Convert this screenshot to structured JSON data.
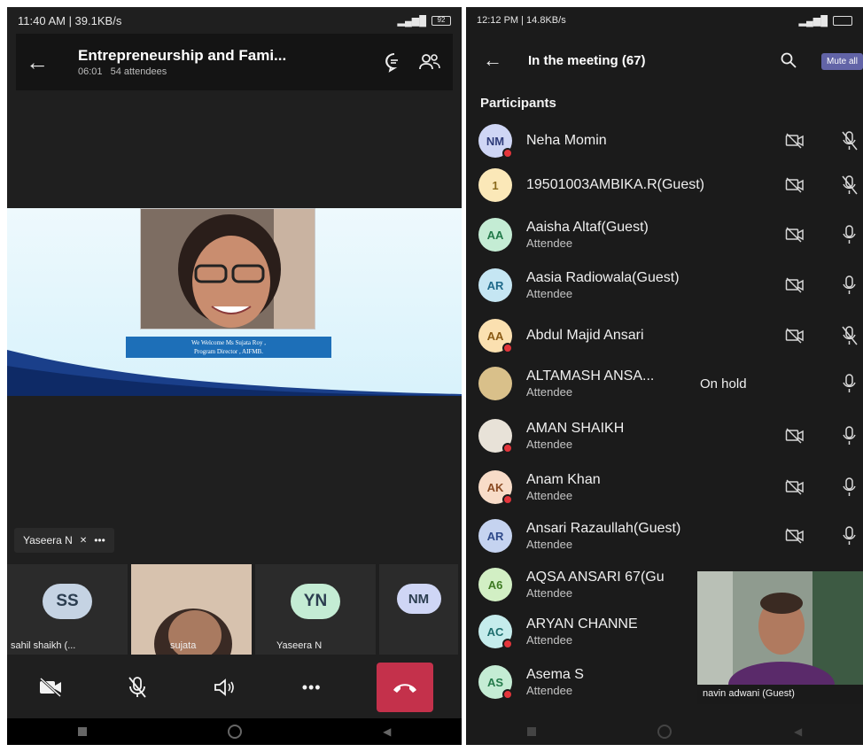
{
  "left": {
    "status": {
      "time": "11:40 AM | 39.1KB/s",
      "battery": "92"
    },
    "header": {
      "title": "Entrepreneurship and Fami...",
      "duration": "06:01",
      "attendees": "54 attendees"
    },
    "slide": {
      "caption_line1": "We Welcome Ms Sujata Roy ,",
      "caption_line2": "Program Director , AIFMB."
    },
    "name_chip": {
      "name": "Yaseera N",
      "more": "•••"
    },
    "tiles": [
      {
        "initials": "SS",
        "label": "sahil shaikh (...",
        "color": "#c5d3e3"
      },
      {
        "initials": "",
        "label": "sujata",
        "color": ""
      },
      {
        "initials": "YN",
        "label": "Yaseera N",
        "color": "#c4ecd4"
      },
      {
        "initials": "NM",
        "label": "",
        "color": "#cfd6f5"
      }
    ],
    "controls": {
      "camera_icon": "camera-off-icon",
      "mic_icon": "mic-off-icon",
      "speaker_icon": "speaker-icon",
      "more_label": "•••",
      "hangup_icon": "hangup-icon"
    }
  },
  "right": {
    "status": {
      "time": "12:12 PM | 14.8KB/s"
    },
    "header": {
      "title": "In the meeting (67)",
      "mute_all": "Mute all"
    },
    "section": "Participants",
    "participants": [
      {
        "initials": "NM",
        "name": "Neha Momin",
        "role": "",
        "avatar_bg": "#cfd6f5",
        "avatar_fg": "#2f3c7a",
        "dot": true,
        "cam": true,
        "mic": "off",
        "status": ""
      },
      {
        "initials": "1",
        "name": "19501003AMBIKA.R(Guest)",
        "role": "",
        "avatar_bg": "#fbe8b8",
        "avatar_fg": "#8a6a1c",
        "dot": false,
        "cam": true,
        "mic": "off",
        "status": ""
      },
      {
        "initials": "AA",
        "name": "Aaisha Altaf(Guest)",
        "role": "Attendee",
        "avatar_bg": "#c4ecd4",
        "avatar_fg": "#237a4a",
        "dot": false,
        "cam": true,
        "mic": "on",
        "status": ""
      },
      {
        "initials": "AR",
        "name": "Aasia Radiowala(Guest)",
        "role": "Attendee",
        "avatar_bg": "#c5e6f3",
        "avatar_fg": "#1f6a8a",
        "dot": false,
        "cam": true,
        "mic": "on",
        "status": ""
      },
      {
        "initials": "AA",
        "name": "Abdul Majid Ansari",
        "role": "",
        "avatar_bg": "#fbe0b0",
        "avatar_fg": "#8a5a14",
        "dot": true,
        "cam": true,
        "mic": "off",
        "status": ""
      },
      {
        "initials": "",
        "name": "ALTAMASH ANSA...",
        "role": "Attendee",
        "avatar_bg": "#d9c08a",
        "avatar_fg": "#333",
        "dot": false,
        "cam": false,
        "mic": "on",
        "status": "On hold"
      },
      {
        "initials": "",
        "name": "AMAN SHAIKH",
        "role": "Attendee",
        "avatar_bg": "#e8e2d8",
        "avatar_fg": "#333",
        "dot": true,
        "cam": true,
        "mic": "on",
        "status": ""
      },
      {
        "initials": "AK",
        "name": "Anam Khan",
        "role": "Attendee",
        "avatar_bg": "#f8dcc8",
        "avatar_fg": "#8a4a22",
        "dot": true,
        "cam": true,
        "mic": "on",
        "status": ""
      },
      {
        "initials": "AR",
        "name": "Ansari Razaullah(Guest)",
        "role": "Attendee",
        "avatar_bg": "#c5d3f0",
        "avatar_fg": "#2f4a8a",
        "dot": false,
        "cam": true,
        "mic": "on",
        "status": ""
      },
      {
        "initials": "A6",
        "name": "AQSA ANSARI 67(Gu",
        "role": "Attendee",
        "avatar_bg": "#d2efc4",
        "avatar_fg": "#3e7a22",
        "dot": false,
        "cam": false,
        "mic": "",
        "status": ""
      },
      {
        "initials": "AC",
        "name": "ARYAN CHANNE",
        "role": "Attendee",
        "avatar_bg": "#c5ecec",
        "avatar_fg": "#1e6e6e",
        "dot": true,
        "cam": false,
        "mic": "",
        "status": ""
      },
      {
        "initials": "AS",
        "name": "Asema S",
        "role": "Attendee",
        "avatar_bg": "#c4ecd4",
        "avatar_fg": "#237a4a",
        "dot": true,
        "cam": false,
        "mic": "",
        "status": ""
      }
    ],
    "pip_label": "navin adwani (Guest)"
  }
}
